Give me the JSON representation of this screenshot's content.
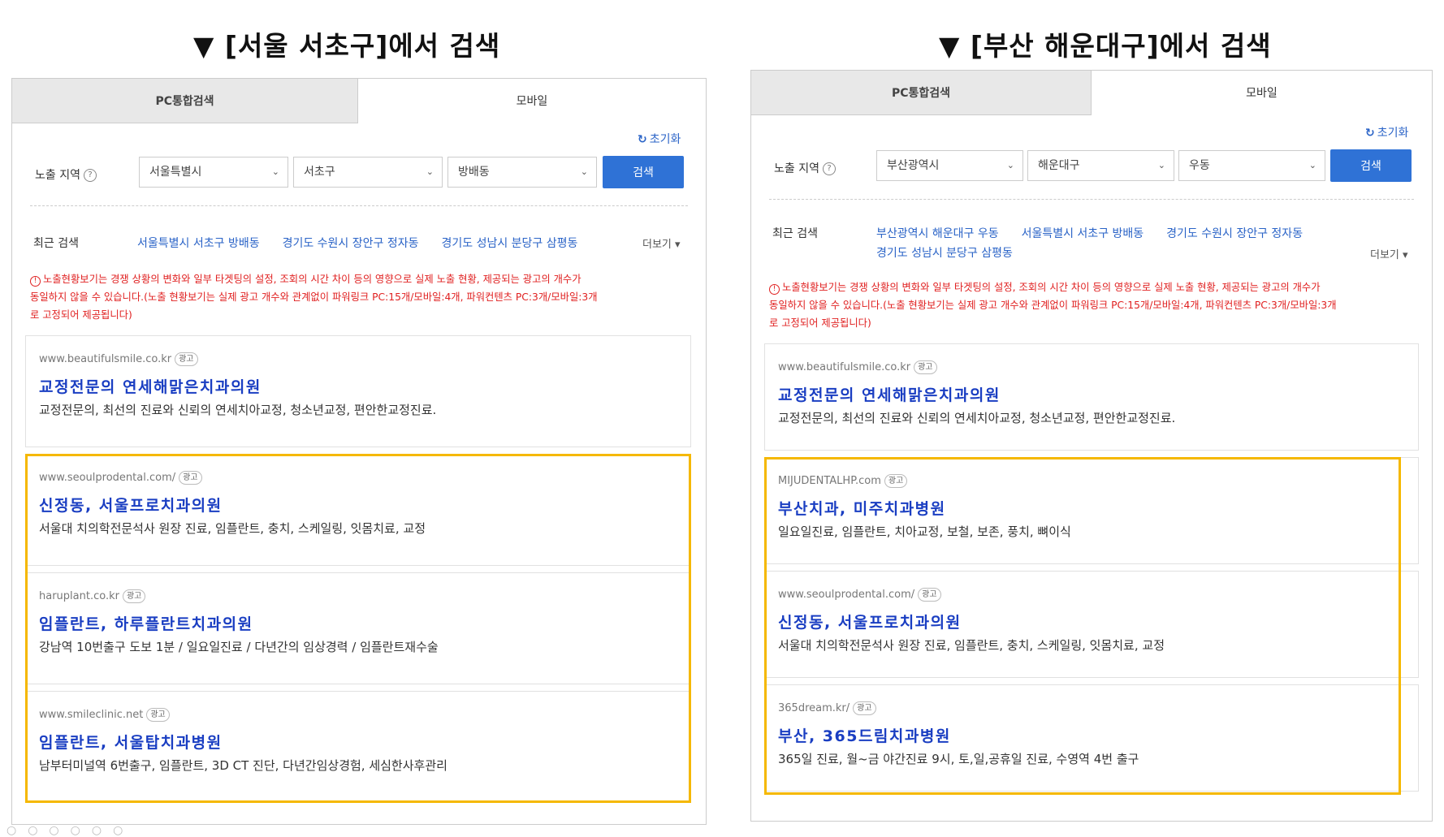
{
  "left": {
    "caption": "▼ [서울 서초구]에서 검색",
    "tabs": {
      "pc": "PC통합검색",
      "mobile": "모바일"
    },
    "reset": "초기화",
    "region_label": "노출 지역",
    "selects": [
      "서울특별시",
      "서초구",
      "방배동"
    ],
    "search_button": "검색",
    "recent_label": "최근 검색",
    "recent_line1": "서울특별시 서초구 방배동　　경기도 수원시 장안구 정자동　　경기도 성남시 분당구 삼평동",
    "recent_line2": "",
    "more": "더보기",
    "notice": [
      "노출현황보기는 경쟁 상황의 변화와 일부 타겟팅의 설정, 조회의 시간 차이 등의 영향으로 실제 노출 현황, 제공되는 광고의 개수가",
      "동일하지 않을 수 있습니다.(노출 현황보기는 실제 광고 개수와 관계없이 파워링크 PC:15개/모바일:4개, 파워컨텐츠 PC:3개/모바일:3개",
      "로 고정되어 제공됩니다)"
    ],
    "ads": [
      {
        "url": "www.beautifulsmile.co.kr",
        "badge": "광고",
        "title": "교정전문의 연세해맑은치과의원",
        "desc": "교정전문의, 최선의 진료와 신뢰의 연세치아교정, 청소년교정, 편안한교정진료."
      },
      {
        "url": "www.seoulprodental.com/",
        "badge": "광고",
        "title": "신정동, 서울프로치과의원",
        "desc": "서울대 치의학전문석사 원장 진료, 임플란트, 충치, 스케일링, 잇몸치료, 교정"
      },
      {
        "url": "haruplant.co.kr",
        "badge": "광고",
        "title": "임플란트, 하루플란트치과의원",
        "desc": "강남역 10번출구 도보 1분 / 일요일진료 / 다년간의 임상경력 / 임플란트재수술"
      },
      {
        "url": "www.smileclinic.net",
        "badge": "광고",
        "title": "임플란트, 서울탑치과병원",
        "desc": "남부터미널역 6번출구, 임플란트, 3D CT 진단, 다년간임상경험, 세심한사후관리"
      }
    ]
  },
  "right": {
    "caption": "▼ [부산 해운대구]에서 검색",
    "tabs": {
      "pc": "PC통합검색",
      "mobile": "모바일"
    },
    "reset": "초기화",
    "region_label": "노출 지역",
    "selects": [
      "부산광역시",
      "해운대구",
      "우동"
    ],
    "search_button": "검색",
    "recent_label": "최근 검색",
    "recent_line1": "부산광역시 해운대구 우동　　서울특별시 서초구 방배동　　경기도 수원시 장안구 정자동",
    "recent_line2": "경기도 성남시 분당구 삼평동",
    "more": "더보기",
    "notice": [
      "노출현황보기는 경쟁 상황의 변화와 일부 타겟팅의 설정, 조회의 시간 차이 등의 영향으로 실제 노출 현황, 제공되는 광고의 개수가",
      "동일하지 않을 수 있습니다.(노출 현황보기는 실제 광고 개수와 관계없이 파워링크 PC:15개/모바일:4개, 파워컨텐츠 PC:3개/모바일:3개",
      "로 고정되어 제공됩니다)"
    ],
    "ads": [
      {
        "url": "www.beautifulsmile.co.kr",
        "badge": "광고",
        "title": "교정전문의 연세해맑은치과의원",
        "desc": "교정전문의, 최선의 진료와 신뢰의 연세치아교정, 청소년교정, 편안한교정진료."
      },
      {
        "url": "MIJUDENTALHP.com",
        "badge": "광고",
        "title": "부산치과, 미주치과병원",
        "desc": "일요일진료, 임플란트, 치아교정, 보철, 보존, 풍치, 뼈이식"
      },
      {
        "url": "www.seoulprodental.com/",
        "badge": "광고",
        "title": "신정동, 서울프로치과의원",
        "desc": "서울대 치의학전문석사 원장 진료, 임플란트, 충치, 스케일링, 잇몸치료, 교정"
      },
      {
        "url": "365dream.kr/",
        "badge": "광고",
        "title": "부산, 365드림치과병원",
        "desc": "365일 진료, 월~금 야간진료 9시, 토,일,공휴일 진료, 수영역 4번 출구"
      }
    ]
  }
}
